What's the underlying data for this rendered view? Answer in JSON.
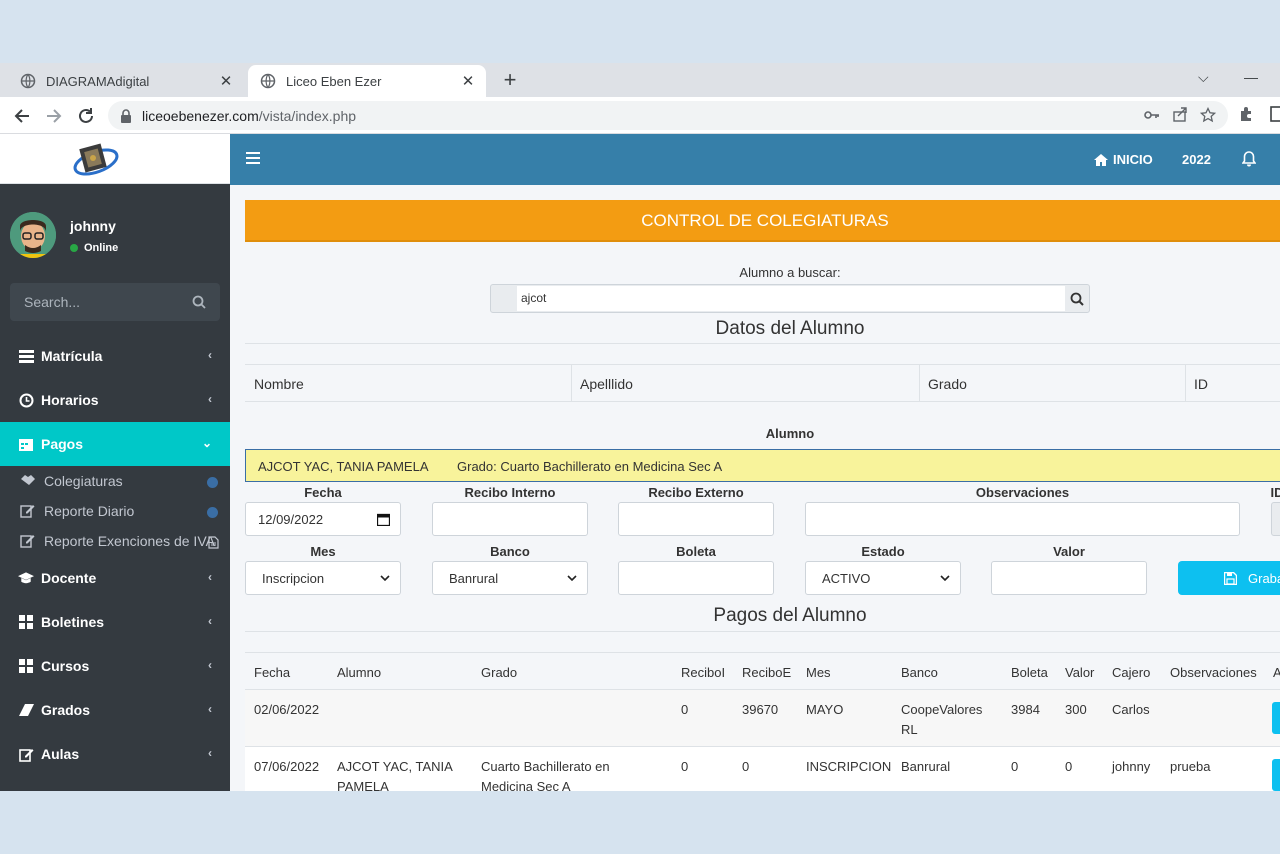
{
  "browser": {
    "tabs": [
      {
        "title": "DIAGRAMAdigital",
        "active": false
      },
      {
        "title": "Liceo Eben Ezer",
        "active": true
      }
    ],
    "url_domain": "liceoebenezer.com",
    "url_path": "/vista/index.php"
  },
  "sidebar": {
    "user_name": "johnny",
    "user_status": "Online",
    "search_placeholder": "Search...",
    "items": [
      {
        "label": "Matrícula",
        "icon": "list-icon"
      },
      {
        "label": "Horarios",
        "icon": "clock-icon"
      },
      {
        "label": "Pagos",
        "icon": "calendar-icon",
        "active": true
      },
      {
        "label": "Docente",
        "icon": "graduation-cap-icon"
      },
      {
        "label": "Boletines",
        "icon": "grid-icon"
      },
      {
        "label": "Cursos",
        "icon": "grid-icon"
      },
      {
        "label": "Grados",
        "icon": "eraser-icon"
      },
      {
        "label": "Aulas",
        "icon": "edit-icon"
      }
    ],
    "sub_items": [
      {
        "label": "Colegiaturas",
        "icon": "handshake-icon"
      },
      {
        "label": "Reporte Diario",
        "icon": "edit-icon"
      },
      {
        "label": "Reporte Exenciones de IVA",
        "icon": "edit-icon"
      }
    ]
  },
  "topbar": {
    "inicio": "INICIO",
    "year": "2022"
  },
  "banner": "CONTROL DE COLEGIATURAS",
  "search": {
    "label": "Alumno a buscar:",
    "value": "ajcot"
  },
  "datos": {
    "title": "Datos del Alumno",
    "headers": [
      "Nombre",
      "Apelllido",
      "Grado",
      "ID"
    ]
  },
  "alumno": {
    "label": "Alumno",
    "name": "AJCOT YAC, TANIA PAMELA",
    "grado": "Grado: Cuarto Bachillerato en Medicina Sec A"
  },
  "form": {
    "fecha_label": "Fecha",
    "fecha_value": "12/09/2022",
    "recibo_interno_label": "Recibo Interno",
    "recibo_externo_label": "Recibo Externo",
    "observaciones_label": "Observaciones",
    "id_label": "ID",
    "mes_label": "Mes",
    "mes_value": "Inscripcion",
    "banco_label": "Banco",
    "banco_value": "Banrural",
    "boleta_label": "Boleta",
    "estado_label": "Estado",
    "estado_value": "ACTIVO",
    "valor_label": "Valor",
    "save_label": "Graba"
  },
  "pagos": {
    "title": "Pagos del Alumno",
    "headers": [
      "Fecha",
      "Alumno",
      "Grado",
      "ReciboI",
      "ReciboE",
      "Mes",
      "Banco",
      "Boleta",
      "Valor",
      "Cajero",
      "Observaciones",
      "A"
    ],
    "rows": [
      {
        "fecha": "02/06/2022",
        "alumno": "",
        "grado": "",
        "reciboi": "0",
        "reciboe": "39670",
        "mes": "MAYO",
        "banco": "CoopeValores RL",
        "boleta": "3984",
        "valor": "300",
        "cajero": "Carlos",
        "obs": ""
      },
      {
        "fecha": "07/06/2022",
        "alumno": "AJCOT YAC, TANIA PAMELA",
        "grado": "Cuarto Bachillerato en Medicina Sec A",
        "reciboi": "0",
        "reciboe": "0",
        "mes": "INSCRIPCION",
        "banco": "Banrural",
        "boleta": "0",
        "valor": "0",
        "cajero": "johnny",
        "obs": "prueba"
      }
    ]
  }
}
